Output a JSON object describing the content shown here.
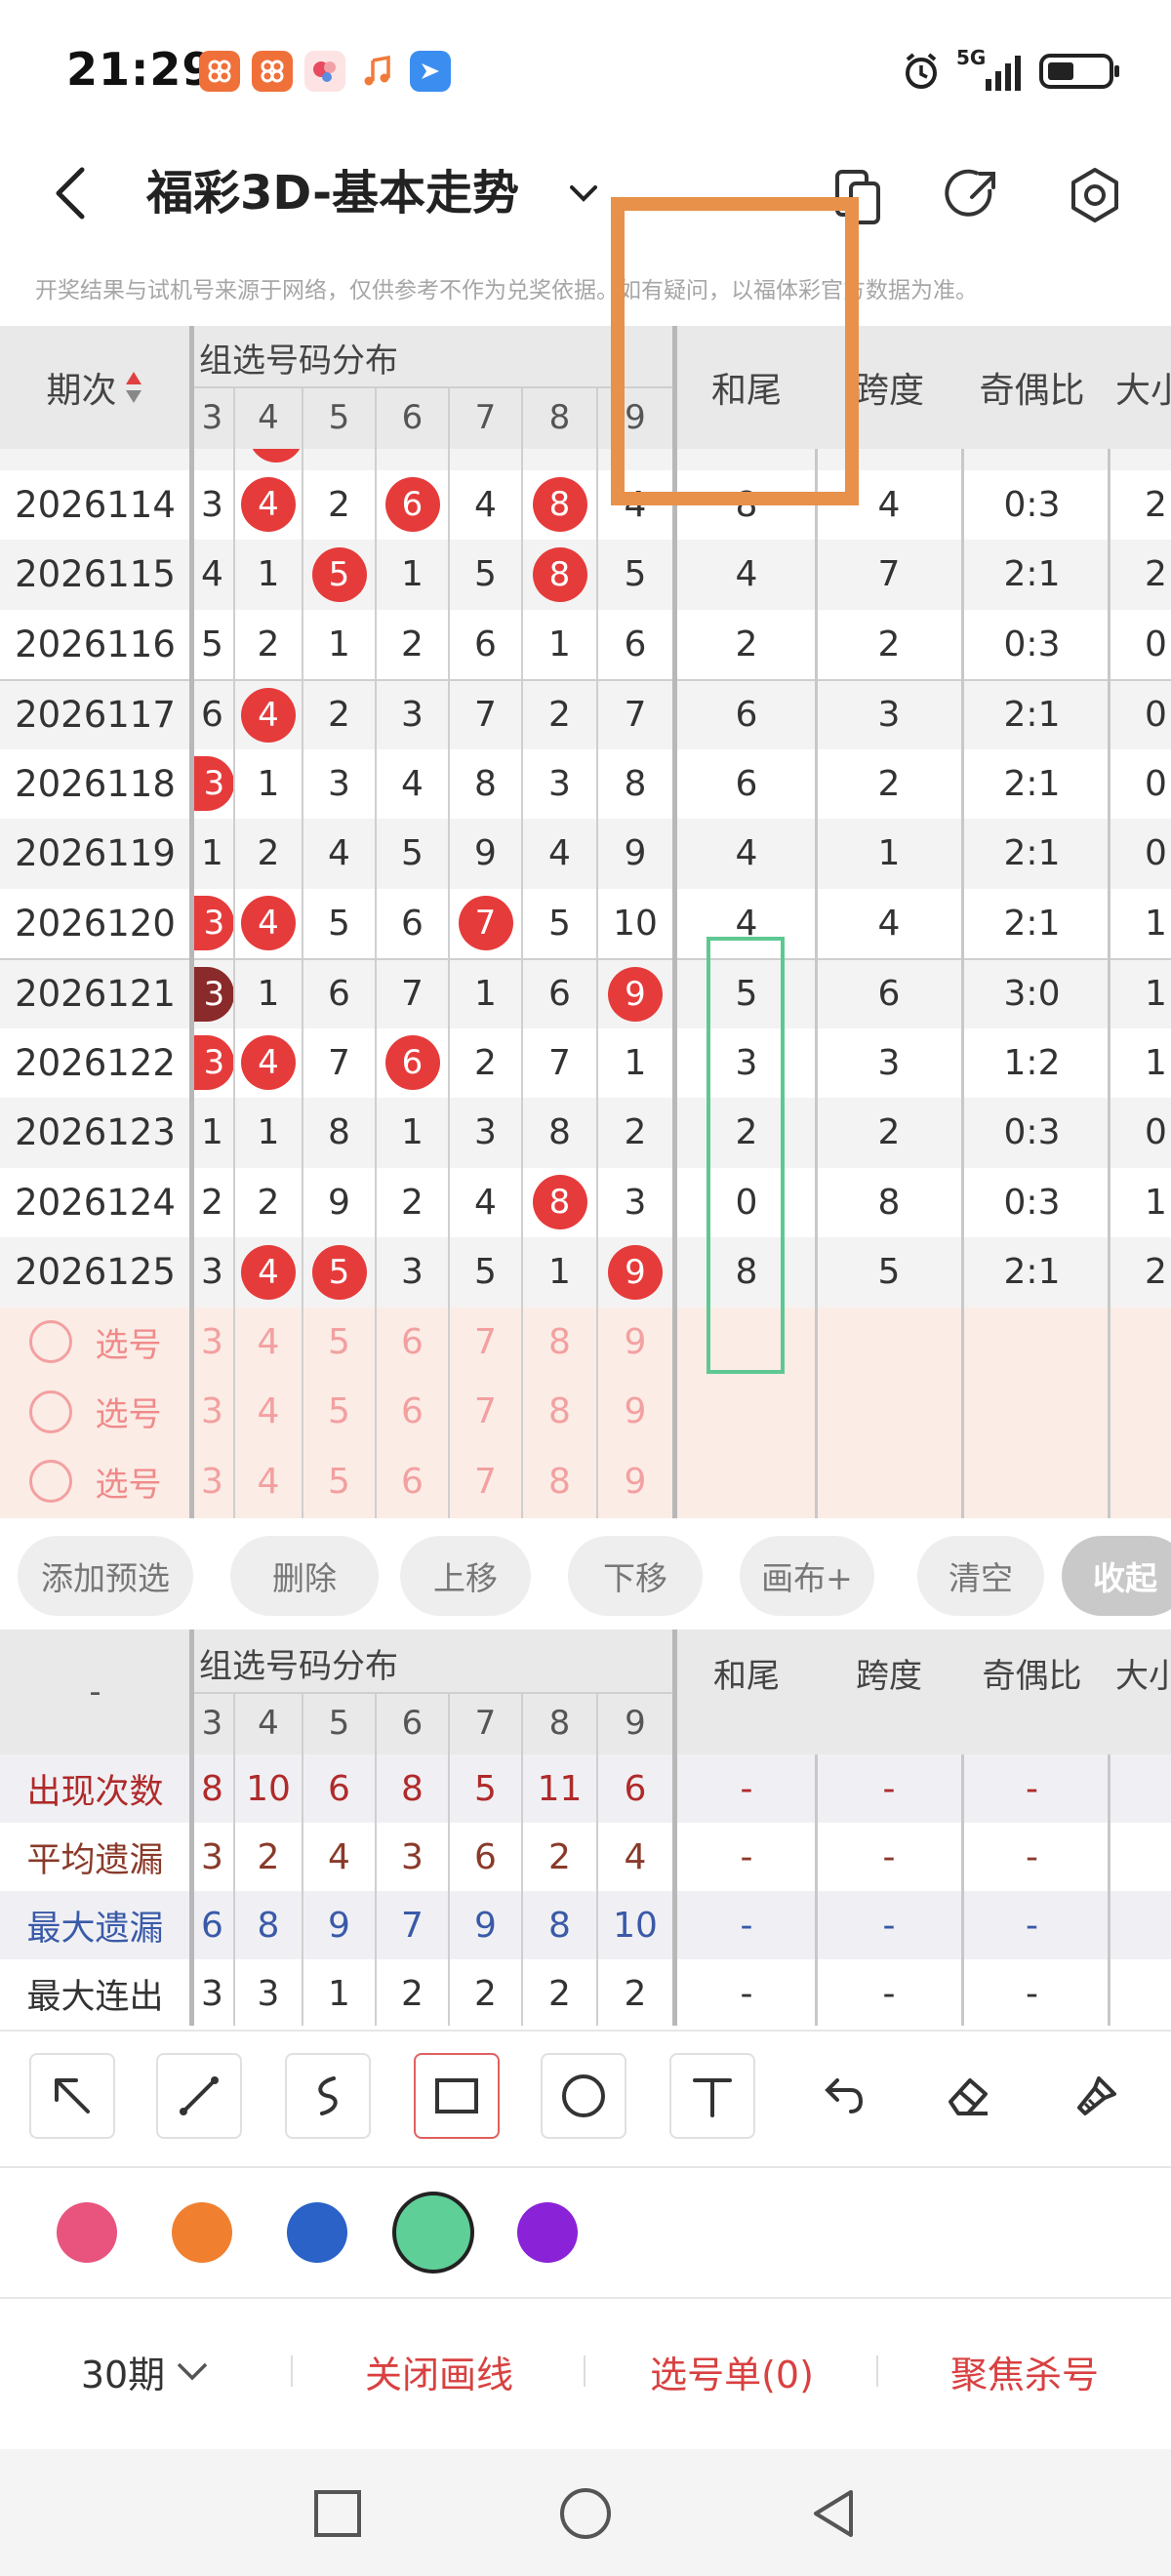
{
  "status_bar": {
    "time": "21:29",
    "network": "5G",
    "app_icons": [
      "app-icon-1",
      "app-icon-2",
      "app-icon-3",
      "music-icon",
      "bird-icon"
    ]
  },
  "header": {
    "title": "福彩3D-基本走势"
  },
  "disclaimer": "开奖结果与试机号来源于网络，仅供参考不作为兑奖依据。如有疑问，以福体彩官方数据为准。",
  "table": {
    "col_period": "期次",
    "group_header": "组选号码分布",
    "digit_cols": [
      "3",
      "4",
      "5",
      "6",
      "7",
      "8",
      "9"
    ],
    "col_hewei": "和尾",
    "col_kuadu": "跨度",
    "col_jiou": "奇偶比",
    "col_daxiao": "大小",
    "rows": [
      {
        "period": "2026114",
        "d": [
          "3",
          "4",
          "2",
          "6",
          "4",
          "8",
          "4"
        ],
        "balls": [
          1,
          3,
          5
        ],
        "hewei": "8",
        "kuadu": "4",
        "jiou": "0:3",
        "daxiao": "2"
      },
      {
        "period": "2026115",
        "d": [
          "4",
          "1",
          "5",
          "1",
          "5",
          "8",
          "5"
        ],
        "balls": [
          2,
          5
        ],
        "hewei": "4",
        "kuadu": "7",
        "jiou": "2:1",
        "daxiao": "2"
      },
      {
        "period": "2026116",
        "d": [
          "5",
          "2",
          "1",
          "2",
          "6",
          "1",
          "6"
        ],
        "balls": [],
        "hewei": "2",
        "kuadu": "2",
        "jiou": "0:3",
        "daxiao": "0"
      },
      {
        "period": "2026117",
        "d": [
          "6",
          "4",
          "2",
          "3",
          "7",
          "2",
          "7"
        ],
        "balls": [
          1
        ],
        "hewei": "6",
        "kuadu": "3",
        "jiou": "2:1",
        "daxiao": "0"
      },
      {
        "period": "2026118",
        "d": [
          "3",
          "1",
          "3",
          "4",
          "8",
          "3",
          "8"
        ],
        "balls": [
          0
        ],
        "hewei": "6",
        "kuadu": "2",
        "jiou": "2:1",
        "daxiao": "0"
      },
      {
        "period": "2026119",
        "d": [
          "1",
          "2",
          "4",
          "5",
          "9",
          "4",
          "9"
        ],
        "balls": [],
        "hewei": "4",
        "kuadu": "1",
        "jiou": "2:1",
        "daxiao": "0"
      },
      {
        "period": "2026120",
        "d": [
          "3",
          "4",
          "5",
          "6",
          "7",
          "5",
          "10"
        ],
        "balls": [
          0,
          1,
          4
        ],
        "hewei": "4",
        "kuadu": "4",
        "jiou": "2:1",
        "daxiao": "1"
      },
      {
        "period": "2026121",
        "d": [
          "3",
          "1",
          "6",
          "7",
          "1",
          "6",
          "9"
        ],
        "balls": [
          0,
          6
        ],
        "dark": [
          0
        ],
        "hewei": "5",
        "kuadu": "6",
        "jiou": "3:0",
        "daxiao": "1"
      },
      {
        "period": "2026122",
        "d": [
          "3",
          "4",
          "7",
          "6",
          "2",
          "7",
          "1"
        ],
        "balls": [
          0,
          1,
          3
        ],
        "hewei": "3",
        "kuadu": "3",
        "jiou": "1:2",
        "daxiao": "1"
      },
      {
        "period": "2026123",
        "d": [
          "1",
          "1",
          "8",
          "1",
          "3",
          "8",
          "2"
        ],
        "balls": [],
        "hewei": "2",
        "kuadu": "2",
        "jiou": "0:3",
        "daxiao": "0"
      },
      {
        "period": "2026124",
        "d": [
          "2",
          "2",
          "9",
          "2",
          "4",
          "8",
          "3"
        ],
        "balls": [
          5
        ],
        "hewei": "0",
        "kuadu": "8",
        "jiou": "0:3",
        "daxiao": "1"
      },
      {
        "period": "2026125",
        "d": [
          "3",
          "4",
          "5",
          "3",
          "5",
          "1",
          "9"
        ],
        "balls": [
          1,
          2,
          6
        ],
        "hewei": "8",
        "kuadu": "5",
        "jiou": "2:1",
        "daxiao": "2"
      }
    ],
    "pick_rows": [
      {
        "label": "选号",
        "d": [
          "3",
          "4",
          "5",
          "6",
          "7",
          "8",
          "9"
        ]
      },
      {
        "label": "选号",
        "d": [
          "3",
          "4",
          "5",
          "6",
          "7",
          "8",
          "9"
        ]
      },
      {
        "label": "选号",
        "d": [
          "3",
          "4",
          "5",
          "6",
          "7",
          "8",
          "9"
        ]
      }
    ]
  },
  "actions": [
    "添加预选",
    "删除",
    "上移",
    "下移",
    "画布+",
    "清空",
    "收起"
  ],
  "stats": {
    "dash": "-",
    "group_header": "组选号码分布",
    "digit_cols": [
      "3",
      "4",
      "5",
      "6",
      "7",
      "8",
      "9"
    ],
    "col_hewei": "和尾",
    "col_kuadu": "跨度",
    "col_jiou": "奇偶比",
    "col_daxiao": "大小",
    "rows": [
      {
        "label": "出现次数",
        "color": "#b02a2a",
        "d": [
          "8",
          "10",
          "6",
          "8",
          "5",
          "11",
          "6"
        ],
        "rest": [
          "-",
          "-",
          "-"
        ]
      },
      {
        "label": "平均遗漏",
        "color": "#8a3a2a",
        "d": [
          "3",
          "2",
          "4",
          "3",
          "6",
          "2",
          "4"
        ],
        "rest": [
          "-",
          "-",
          "-"
        ]
      },
      {
        "label": "最大遗漏",
        "color": "#3a5aa8",
        "d": [
          "6",
          "8",
          "9",
          "7",
          "9",
          "8",
          "10"
        ],
        "rest": [
          "-",
          "-",
          "-"
        ]
      },
      {
        "label": "最大连出",
        "color": "#333333",
        "d": [
          "3",
          "3",
          "1",
          "2",
          "2",
          "2",
          "2"
        ],
        "rest": [
          "-",
          "-",
          "-"
        ]
      }
    ]
  },
  "colors": {
    "swatches": [
      "#e9547f",
      "#f08030",
      "#2a62c8",
      "#5fcf98",
      "#8a22d8"
    ],
    "accent": "#e14040",
    "orange_box": "#e8914a",
    "green_box": "#5ec892"
  },
  "bottom_bar": {
    "period_select": "30期",
    "close_lines": "关闭画线",
    "pick_list": "选号单(0)",
    "focus_kill": "聚焦杀号"
  }
}
